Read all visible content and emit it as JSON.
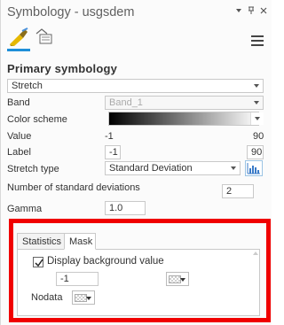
{
  "window": {
    "title": "Symbology - usgsdem",
    "controls": {
      "minimize": "▾",
      "pin": "ᵽ",
      "close": "×"
    }
  },
  "tabs_icons": [
    {
      "name": "primary-symbology-tab",
      "icon": "paint-brush-icon",
      "active": true
    },
    {
      "name": "mask-tab",
      "icon": "mask-image-icon",
      "active": false
    }
  ],
  "section": {
    "title": "Primary symbology"
  },
  "renderer": {
    "value": "Stretch"
  },
  "fields": {
    "band_label": "Band",
    "band_value": "Band_1",
    "color_scheme_label": "Color scheme",
    "value_label": "Value",
    "value_min": "-1",
    "value_max": "90",
    "label_label": "Label",
    "label_min": "-1",
    "label_max": "90",
    "stretch_type_label": "Stretch type",
    "stretch_type_value": "Standard Deviation",
    "std_dev_label": "Number of standard deviations",
    "std_dev_value": "2",
    "gamma_label": "Gamma",
    "gamma_value": "1.0"
  },
  "splitter": "....",
  "lower": {
    "tabs": [
      "Statistics",
      "Mask"
    ],
    "active_tab": "Mask",
    "display_background_label": "Display background value",
    "display_background_checked": true,
    "background_value": "-1",
    "nodata_label": "Nodata"
  },
  "colors": {
    "accent": "#1e8fd8",
    "highlight": "#f00000"
  }
}
